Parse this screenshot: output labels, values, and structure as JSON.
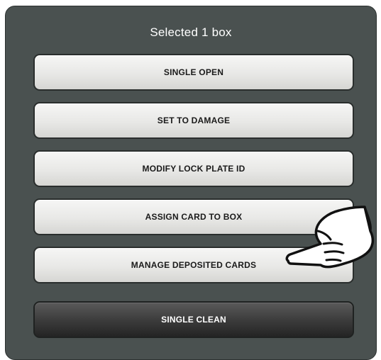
{
  "dialog": {
    "title": "Selected 1 box",
    "buttons": [
      {
        "label": "SINGLE OPEN"
      },
      {
        "label": "SET TO DAMAGE"
      },
      {
        "label": "MODIFY LOCK PLATE ID"
      },
      {
        "label": "ASSIGN CARD TO BOX"
      },
      {
        "label": "MANAGE DEPOSITED CARDS"
      },
      {
        "label": "SINGLE CLEAN"
      }
    ]
  },
  "pointer": {
    "icon": "pointing-hand-icon"
  },
  "colors": {
    "dialog_background": "#4a5150",
    "light_button": "#e8e8e6",
    "dark_button": "#3a3a3a",
    "title_text": "#ffffff"
  }
}
